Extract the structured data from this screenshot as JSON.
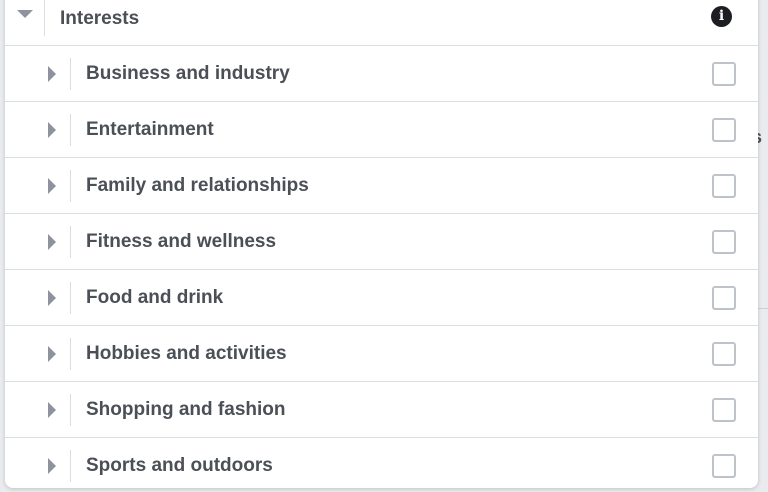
{
  "panel": {
    "header": {
      "title": "Interests",
      "expanded": true,
      "info_icon": "info-icon"
    },
    "categories": [
      {
        "label": "Business and industry",
        "checked": false
      },
      {
        "label": "Entertainment",
        "checked": false
      },
      {
        "label": "Family and relationships",
        "checked": false
      },
      {
        "label": "Fitness and wellness",
        "checked": false
      },
      {
        "label": "Food and drink",
        "checked": false
      },
      {
        "label": "Hobbies and activities",
        "checked": false
      },
      {
        "label": "Shopping and fashion",
        "checked": false
      },
      {
        "label": "Sports and outdoors",
        "checked": false
      }
    ]
  },
  "background": {
    "partial_text": "s"
  },
  "colors": {
    "text": "#4b4f56",
    "divider": "#dadde1",
    "caret": "#8d949e",
    "checkbox_border": "#bec3c9",
    "page_background": "#e9ebee"
  }
}
